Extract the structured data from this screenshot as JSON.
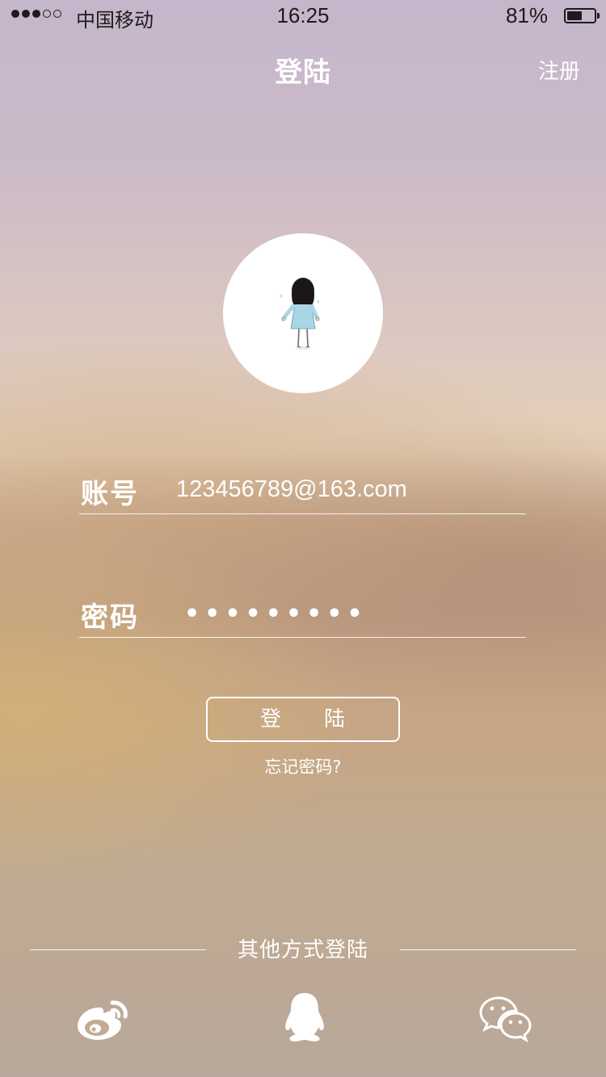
{
  "status_bar": {
    "carrier": "中国移动",
    "time": "16:25",
    "battery_percent_text": "81%",
    "battery_level": 0.81,
    "signal_bars_filled": 3,
    "signal_bars_total": 5
  },
  "nav": {
    "title": "登陆",
    "register_label": "注册"
  },
  "form": {
    "account_label": "账号",
    "account_value": "123456789@163.com",
    "password_label": "密码",
    "password_mask": "•••••••••",
    "login_button_chars": [
      "登",
      "陆"
    ],
    "forgot_password": "忘记密码?"
  },
  "other_login": {
    "label": "其他方式登陆",
    "providers": [
      {
        "icon": "weibo-icon"
      },
      {
        "icon": "qq-icon"
      },
      {
        "icon": "wechat-icon"
      }
    ]
  },
  "colors": {
    "text_primary": "#ffffff",
    "status_text": "#1e1a1c",
    "avatar_bg": "#ffffff",
    "figure_dress": "#a9d6e6"
  }
}
